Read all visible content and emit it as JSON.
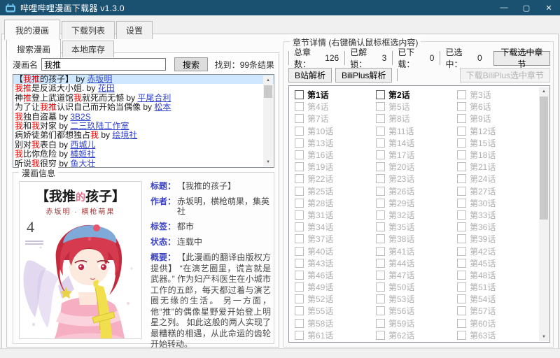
{
  "window": {
    "title": "哔哩哔哩漫画下载器 v1.3.0",
    "controls": {
      "minimize": "—",
      "maximize": "▢",
      "close": "✕"
    },
    "titlebar_color": "#1b5170"
  },
  "tabs": [
    {
      "label": "我的漫画",
      "selected": true
    },
    {
      "label": "下载列表",
      "selected": false
    },
    {
      "label": "设置",
      "selected": false
    }
  ],
  "left": {
    "subtabs": [
      {
        "label": "搜索漫画",
        "selected": true
      },
      {
        "label": "本地库存",
        "selected": false
      }
    ],
    "search": {
      "label": "漫画名",
      "value": "我推",
      "button": "搜索",
      "result_count": "找到：99条结果"
    },
    "results": [
      {
        "selected": true,
        "segments": [
          {
            "t": "【",
            "c": "k"
          },
          {
            "t": "我推",
            "c": "r"
          },
          {
            "t": "的孩子】 by ",
            "c": "k"
          },
          {
            "t": "赤坂明",
            "c": "a"
          }
        ]
      },
      {
        "selected": false,
        "segments": [
          {
            "t": "我推",
            "c": "r"
          },
          {
            "t": "是反派大小姐. by ",
            "c": "k"
          },
          {
            "t": "花田",
            "c": "a"
          }
        ]
      },
      {
        "selected": false,
        "segments": [
          {
            "t": "神",
            "c": "k"
          },
          {
            "t": "推",
            "c": "r"
          },
          {
            "t": "登上武道馆",
            "c": "k"
          },
          {
            "t": "我",
            "c": "r"
          },
          {
            "t": "就死而无憾 by ",
            "c": "k"
          },
          {
            "t": "平尾合利",
            "c": "a"
          }
        ]
      },
      {
        "selected": false,
        "segments": [
          {
            "t": "为了让",
            "c": "k"
          },
          {
            "t": "我推",
            "c": "r"
          },
          {
            "t": "认识自己而开始当偶像 by ",
            "c": "k"
          },
          {
            "t": "松本",
            "c": "a"
          }
        ]
      },
      {
        "selected": false,
        "segments": [
          {
            "t": "我",
            "c": "r"
          },
          {
            "t": "独自盗墓 by ",
            "c": "k"
          },
          {
            "t": "3B2S",
            "c": "a"
          }
        ]
      },
      {
        "selected": false,
        "segments": [
          {
            "t": "我",
            "c": "r"
          },
          {
            "t": "和",
            "c": "k"
          },
          {
            "t": "我",
            "c": "r"
          },
          {
            "t": "对家 by ",
            "c": "k"
          },
          {
            "t": "二三玖陆工作室",
            "c": "a"
          }
        ]
      },
      {
        "selected": false,
        "segments": [
          {
            "t": "病娇徒弟们都想独占",
            "c": "k"
          },
          {
            "t": "我",
            "c": "r"
          },
          {
            "t": " by ",
            "c": "k"
          },
          {
            "t": "绘境社",
            "c": "a"
          }
        ]
      },
      {
        "selected": false,
        "segments": [
          {
            "t": "别对",
            "c": "k"
          },
          {
            "t": "我",
            "c": "r"
          },
          {
            "t": "表白 by ",
            "c": "k"
          },
          {
            "t": "西城儿",
            "c": "a"
          }
        ]
      },
      {
        "selected": false,
        "segments": [
          {
            "t": "我",
            "c": "r"
          },
          {
            "t": "比你危险 by ",
            "c": "k"
          },
          {
            "t": "橘姬社",
            "c": "a"
          }
        ]
      },
      {
        "selected": false,
        "segments": [
          {
            "t": "听说",
            "c": "k"
          },
          {
            "t": "我",
            "c": "r"
          },
          {
            "t": "很穷 by ",
            "c": "k"
          },
          {
            "t": "鱼大壮",
            "c": "a"
          }
        ]
      }
    ],
    "info": {
      "group_title": "漫画信息",
      "cover": {
        "title_t1": "【我推",
        "title_t2": "的",
        "title_t3": "孩子】",
        "authors": "赤坂明 · 横枪萌果",
        "volume": "4"
      },
      "fields": [
        {
          "label": "标题：",
          "value": "【我推的孩子】"
        },
        {
          "label": "作者：",
          "value": "赤坂明，横枪萌果，集英社"
        },
        {
          "label": "标签：",
          "value": "都市"
        },
        {
          "label": "状态：",
          "value": "连载中"
        }
      ],
      "summary_label": "概要：",
      "summary": "【此漫画的翻译由版权方提供】 “在演艺圈里，谎言就是武器。” 作为妇产科医生在小城市工作的五郎，每天都过着与演艺圈无缘的生活。 另一方面，他“推”的偶像星野爱开始登上明星之列。 如此这般的两人实现了最糟糕的相遇，从此命运的齿轮开始转动。"
    }
  },
  "right": {
    "group_title": "章节详情 (右键确认鼠标框选内容)",
    "stats": [
      {
        "label": "总章数：",
        "value": "126"
      },
      {
        "label": "已解锁：",
        "value": "3"
      },
      {
        "label": "已下载：",
        "value": "0"
      },
      {
        "label": "已选中：",
        "value": "0"
      }
    ],
    "buttons": {
      "download_selected": "下载选中章节",
      "parse_bilibili": "B站解析",
      "parse_biliplus": "BiliPlus解析",
      "download_biliplus": "下载BiliPlus选中章节"
    },
    "chapters": {
      "prefix": "第",
      "suffix": "话",
      "from": 1,
      "to": 63,
      "unlocked": [
        1,
        2
      ]
    }
  },
  "colors": {
    "accent_red": "#e60000",
    "link_blue": "#3344cc",
    "label_blue": "#3b43c4",
    "selected_row": "#cfe8ff",
    "titlebar": "#1b5170"
  }
}
